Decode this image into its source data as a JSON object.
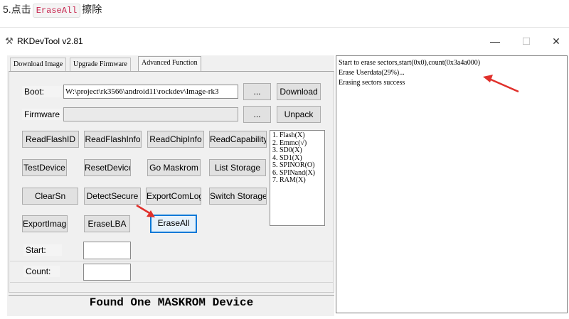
{
  "article": {
    "step_prefix": "5.点击",
    "step_code": "EraseAll",
    "step_suffix": "擦除"
  },
  "window": {
    "title": "RKDevTool v2.81",
    "app_icon": "rk-tool-icon",
    "controls": {
      "minimize": "—",
      "maximize": "☐",
      "close": "✕"
    }
  },
  "tabs": [
    {
      "label": "Download Image"
    },
    {
      "label": "Upgrade Firmware"
    },
    {
      "label": "Advanced Function",
      "active": true
    }
  ],
  "boot": {
    "label": "Boot:",
    "path": "W:\\project\\rk3566\\android11\\rockdev\\Image-rk3",
    "browse_label": "...",
    "action_label": "Download"
  },
  "firmware": {
    "label": "Firmware",
    "path": "",
    "browse_label": "...",
    "action_label": "Unpack"
  },
  "buttons": {
    "read_flash_id": "ReadFlashID",
    "read_flash_info": "ReadFlashInfo",
    "read_chip_info": "ReadChipInfo",
    "read_capability": "ReadCapability",
    "test_device": "TestDevice",
    "reset_device": "ResetDevice",
    "go_maskrom": "Go Maskrom",
    "list_storage": "List Storage",
    "clear_sn": "ClearSn",
    "detect_secure": "DetectSecure",
    "export_com_log": "ExportComLog",
    "switch_storage": "Switch Storage",
    "export_image": "ExportImage",
    "erase_lba": "EraseLBA",
    "erase_all": "EraseAll"
  },
  "storage_list": [
    "1. Flash(X)",
    "2. Emmc(√)",
    "3. SD0(X)",
    "4. SD1(X)",
    "5. SPINOR(O)",
    "6. SPINand(X)",
    "7. RAM(X)"
  ],
  "start": {
    "label": "Start:",
    "value": ""
  },
  "count": {
    "label": "Count:",
    "value": ""
  },
  "status": "Found One MASKROM Device",
  "log": [
    "Start to erase sectors,start(0x0),count(0x3a4a000)",
    "Erase Userdata(29%)...",
    "Erasing sectors success"
  ],
  "colors": {
    "annotation_arrow": "#e0302b",
    "focus_border": "#0078d7",
    "inline_code": "#c7254e"
  }
}
